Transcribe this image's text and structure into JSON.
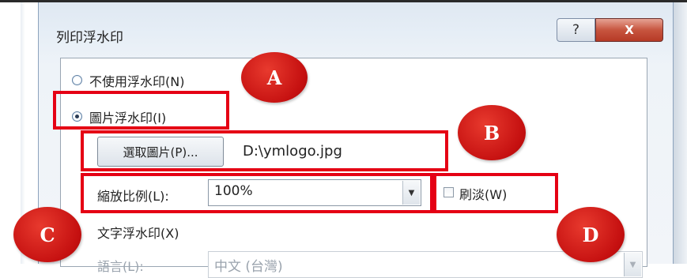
{
  "dialog": {
    "title": "列印浮水印",
    "help_button": "?",
    "close_button": "X"
  },
  "options": {
    "no_watermark": {
      "label": "不使用浮水印(N)",
      "checked": false
    },
    "image_watermark": {
      "label": "圖片浮水印(I)",
      "checked": true
    },
    "text_watermark": {
      "label": "文字浮水印(X)",
      "checked": false
    }
  },
  "image_watermark": {
    "select_button": "選取圖片(P)...",
    "file_path": "D:\\ymlogo.jpg",
    "scale_label": "縮放比例(L):",
    "scale_value": "100%",
    "washout_label": "刷淡(W)",
    "washout_checked": false
  },
  "text_watermark": {
    "language_label": "語言(L):",
    "language_value": "中文 (台灣)"
  },
  "annotations": {
    "A": "A",
    "B": "B",
    "C": "C",
    "D": "D"
  },
  "colors": {
    "highlight": "#e50014",
    "marker": "#c51010"
  }
}
